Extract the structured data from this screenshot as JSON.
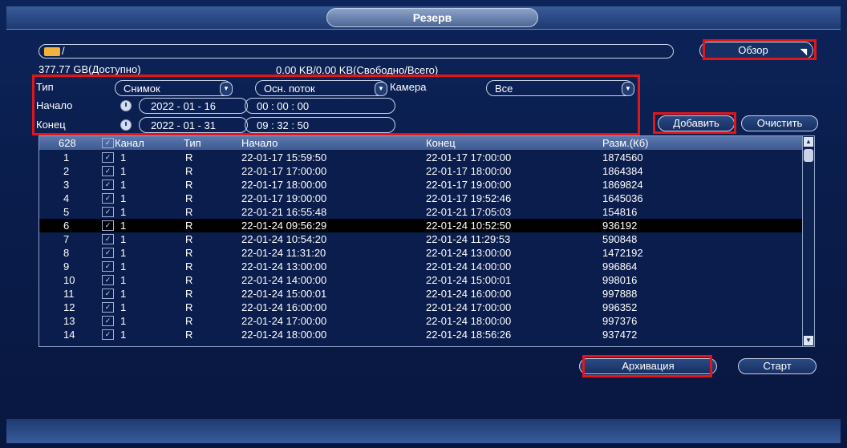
{
  "window": {
    "title": "Резерв"
  },
  "path": {
    "value": "/"
  },
  "storage": {
    "available": "377.77 GB(Доступно)",
    "free_total": "0.00 KB/0.00 KB(Свободно/Всего)"
  },
  "buttons": {
    "browse": "Обзор",
    "add": "Добавить",
    "clear": "Очистить",
    "archive": "Архивация",
    "start": "Старт"
  },
  "filters": {
    "type_label": "Тип",
    "type_value": "Снимок",
    "stream_value": "Осн. поток",
    "camera_label": "Камера",
    "camera_value": "Все",
    "start_label": "Начало",
    "start_date": "2022 - 01 - 16",
    "start_time": "00 : 00 : 00",
    "end_label": "Конец",
    "end_date": "2022 - 01 - 31",
    "end_time": "09 : 32 : 50"
  },
  "table": {
    "headers": {
      "count": "628",
      "channel": "Канал",
      "type": "Тип",
      "start": "Начало",
      "end": "Конец",
      "size": "Разм.(Кб)"
    },
    "rows": [
      {
        "n": "1",
        "ch": "1",
        "t": "R",
        "s": "22-01-17 15:59:50",
        "e": "22-01-17 17:00:00",
        "z": "1874560"
      },
      {
        "n": "2",
        "ch": "1",
        "t": "R",
        "s": "22-01-17 17:00:00",
        "e": "22-01-17 18:00:00",
        "z": "1864384"
      },
      {
        "n": "3",
        "ch": "1",
        "t": "R",
        "s": "22-01-17 18:00:00",
        "e": "22-01-17 19:00:00",
        "z": "1869824"
      },
      {
        "n": "4",
        "ch": "1",
        "t": "R",
        "s": "22-01-17 19:00:00",
        "e": "22-01-17 19:52:46",
        "z": "1645036"
      },
      {
        "n": "5",
        "ch": "1",
        "t": "R",
        "s": "22-01-21 16:55:48",
        "e": "22-01-21 17:05:03",
        "z": "154816"
      },
      {
        "n": "6",
        "ch": "1",
        "t": "R",
        "s": "22-01-24 09:56:29",
        "e": "22-01-24 10:52:50",
        "z": "936192"
      },
      {
        "n": "7",
        "ch": "1",
        "t": "R",
        "s": "22-01-24 10:54:20",
        "e": "22-01-24 11:29:53",
        "z": "590848"
      },
      {
        "n": "8",
        "ch": "1",
        "t": "R",
        "s": "22-01-24 11:31:20",
        "e": "22-01-24 13:00:00",
        "z": "1472192"
      },
      {
        "n": "9",
        "ch": "1",
        "t": "R",
        "s": "22-01-24 13:00:00",
        "e": "22-01-24 14:00:00",
        "z": "996864"
      },
      {
        "n": "10",
        "ch": "1",
        "t": "R",
        "s": "22-01-24 14:00:00",
        "e": "22-01-24 15:00:01",
        "z": "998016"
      },
      {
        "n": "11",
        "ch": "1",
        "t": "R",
        "s": "22-01-24 15:00:01",
        "e": "22-01-24 16:00:00",
        "z": "997888"
      },
      {
        "n": "12",
        "ch": "1",
        "t": "R",
        "s": "22-01-24 16:00:00",
        "e": "22-01-24 17:00:00",
        "z": "996352"
      },
      {
        "n": "13",
        "ch": "1",
        "t": "R",
        "s": "22-01-24 17:00:00",
        "e": "22-01-24 18:00:00",
        "z": "997376"
      },
      {
        "n": "14",
        "ch": "1",
        "t": "R",
        "s": "22-01-24 18:00:00",
        "e": "22-01-24 18:56:26",
        "z": "937472"
      }
    ],
    "selected_row": "6"
  },
  "colors": {
    "highlight": "#e0161b",
    "panel": "#0a1d4c"
  }
}
